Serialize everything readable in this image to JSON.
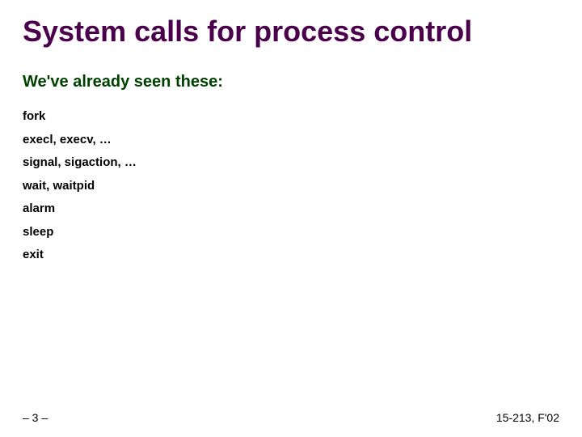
{
  "title": "System calls for process control",
  "subhead": "We've already seen these:",
  "items": [
    "fork",
    "execl, execv, …",
    "signal, sigaction, …",
    "wait, waitpid",
    "alarm",
    "sleep",
    "exit"
  ],
  "footer": {
    "left": "– 3 –",
    "right": "15-213, F'02"
  }
}
